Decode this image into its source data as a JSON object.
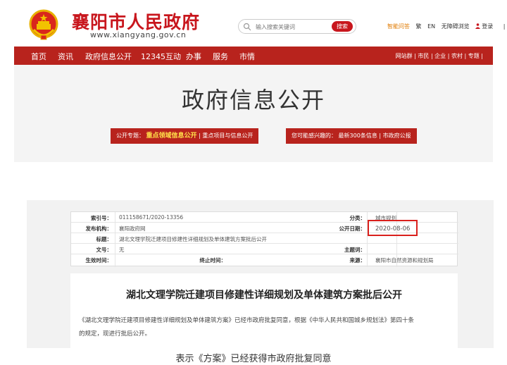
{
  "header": {
    "site_name": "襄阳市人民政府",
    "site_url": "www.xiangyang.gov.cn",
    "search": {
      "placeholder": "输入搜索关键词",
      "button": "搜索"
    },
    "links": {
      "smart_qa": "智能问答",
      "traditional": "繁",
      "english": "EN",
      "accessibility": "无障碍浏览",
      "login": "登录",
      "divider": "|",
      "truncated": "注"
    }
  },
  "nav": {
    "items": [
      "首页",
      "资讯",
      "政府信息公开",
      "12345互动",
      "办事",
      "服务",
      "市情"
    ],
    "right": "网站群 | 市民 | 企业 | 农村 | 专题 |"
  },
  "banner": {
    "title": "政府信息公开",
    "pill_left": {
      "prefix": "公开专题：",
      "highlight": "重点领域信息公开",
      "suffix": "| 重点项目与信息公开"
    },
    "pill_right": {
      "prefix": "您可能感兴趣的：",
      "text": "最新300条信息 | 市政府公报"
    }
  },
  "meta": {
    "index_label": "索引号：",
    "index_value": "011158671/2020-13356",
    "category_label": "分类：",
    "category_value": "城市规划",
    "publisher_label": "发布机构：",
    "publisher_value": "襄阳政府网",
    "date_label": "公开日期：",
    "date_value": "2020-08-06",
    "title_label": "标题：",
    "title_value": "湖北文理学院迁建项目修建性详细规划及单体建筑方案批后公开",
    "docno_label": "文号：",
    "docno_value": "无",
    "subject_label": "主题词：",
    "subject_value": "",
    "effective_label": "生效时间：",
    "effective_value": "",
    "expire_label": "终止时间：",
    "expire_value": "",
    "source_label": "来源：",
    "source_value": "襄阳市自然资源和规划局"
  },
  "doc": {
    "title": "湖北文理学院迁建项目修建性详细规划及单体建筑方案批后公开",
    "body_line1": "《湖北文理学院迁建项目修建性详细规划及单体建筑方案》已经市政府批复同意，根据《中华人民共和国城乡规划法》第四十条",
    "body_line2": "的规定，现进行批后公开。"
  },
  "caption": "表示《方案》已经获得市政府批复同意",
  "colors": {
    "brand_red": "#c8161d",
    "nav_red": "#b8231d",
    "highlight_yellow": "#ffe14a",
    "accent_orange": "#e07a00"
  }
}
